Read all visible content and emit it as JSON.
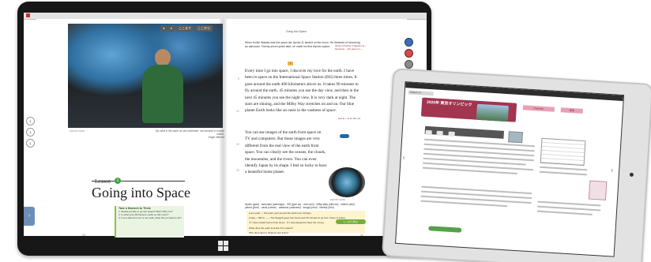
{
  "toolbar": {
    "btn1": "◂",
    "btn2": "▸",
    "btn3": "ここまで",
    "btn4": "ここから"
  },
  "left_page": {
    "photo_caption_left": "PHOTO DATA",
    "photo_caption_right": "My mind is the same as zero-kilometer, not arrested in human nature.",
    "photo_credit": "Edgar Mitchell",
    "lesson_label": "Lesson",
    "lesson_number": "1",
    "lesson_title": "Going into Space",
    "think_title": "Take a Moment to Think",
    "think_items": [
      "1. Would you like to go into space? Why? Why not?",
      "2. Is what your did become really on this moon?",
      "3. If you saw from live or art, hello, what did you want to be?"
    ],
    "page_number": "10"
  },
  "right_page": {
    "header": "Going into Space",
    "intro": "When Koichi Wakata was five years old, Apollo 11 landed on the moon. He dreamed of becoming an astronaut. Twenty-seven years later, he made his first trip into space.",
    "gloss": "dream of being X-happen to ~ becomes ~ (to) goes on ~",
    "marker": "1",
    "body": "Every time I go into space, I discover my love for the earth. I have been in space on the International Space Station (ISS) three times. It goes around the earth 400 kilometers above us. It takes 90 minutes to fly around the earth. 45 minutes you see the day view, and then in the next 45 minutes you see the night view. It is very dark at night. The stars are shining, and the Milky Way stretches on and on. Our blue planet Earth looks like an oasis in the vastness of space.",
    "body2": "You can see images of the earth from space on TV and computers. But those images are very different from the real view of the earth from space. You can clearly see the oceans, the clouds, the mountains, and the rivers. You can even identify Japan by its shape. I feel so lucky to have a beautiful home planet.",
    "line_numbers": [
      "5",
      "10",
      "15",
      "20"
    ],
    "side_gloss": "feel at ~ to be left out",
    "porthole_caption": "PHOTO DATA",
    "vocab": "Apollo (gold) · astronaut (astrologo) · ISS (give ac) · view (dol) · Milky Way (milk ws) · stretch (strn) · planet (plntr) · oasis (orinse) · vastness (vastness) · image (imrd) · identify (ldnr)",
    "grammar_line1": "A  as usual — The team year around the earth over 20 days.",
    "grammar_line2": "A  take ~ 090 to ~ — The Seagull (goes two hours and 30 minutes to go from Tokyo to Kobe).",
    "practice1": "① I have visited Kyoto three times.",
    "practice2": "② I was pleased to have the money.",
    "q1": "What does the earth look like from space?",
    "q2": "Why does land to distance feel lucky?",
    "green_button": "しっかり学ぶ",
    "page_number": "11"
  },
  "ipad": {
    "strip": "Lesson 2-1",
    "title": "2020年 東京オリンピック",
    "header_a": "Grammar",
    "header_b": "表現"
  },
  "colors": {
    "tablet_frame": "#171717",
    "lesson_badge": "#43a047",
    "think_bg": "#eaf4e2",
    "ipad_title": "#a23550"
  },
  "icons": {
    "windows": "windows-logo-icon",
    "nav_left": "chevron-left-icon",
    "nav_right": "chevron-right-icon"
  }
}
